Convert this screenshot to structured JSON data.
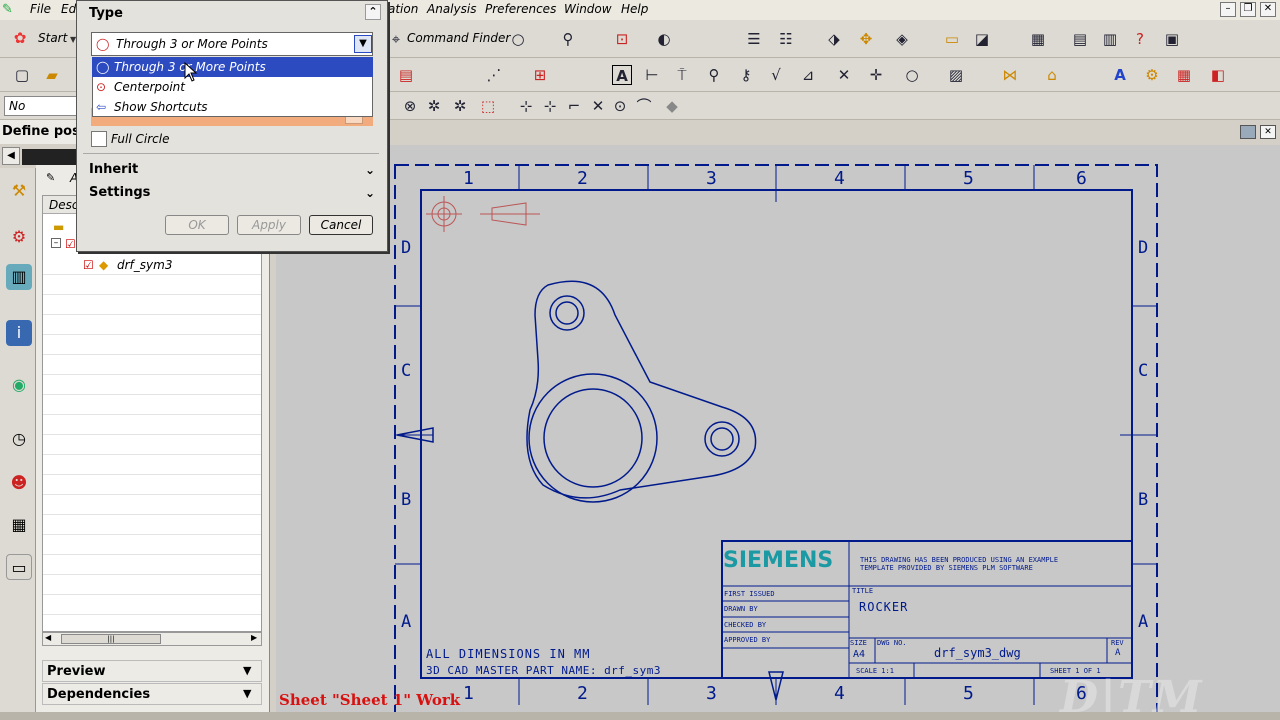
{
  "menubar": {
    "items": [
      "File",
      "Edi",
      "ation",
      "Analysis",
      "Preferences",
      "Window",
      "Help"
    ]
  },
  "toolbar": {
    "start_label": "Start",
    "command_finder_label": "Command Finder",
    "selection_filter": "No Selection"
  },
  "cue_line": "Define posi",
  "navigator": {
    "column_header": "Desc",
    "item_label": "drf_sym3",
    "preview_label": "Preview",
    "dependencies_label": "Dependencies"
  },
  "dialog": {
    "type_header": "Type",
    "selected_type": "Through 3 or More Points",
    "options": [
      "Through 3 or More Points",
      "Centerpoint",
      "Show Shortcuts"
    ],
    "full_circle_label": "Full Circle",
    "inherit_header": "Inherit",
    "settings_header": "Settings",
    "ok_label": "OK",
    "apply_label": "Apply",
    "cancel_label": "Cancel"
  },
  "drawing": {
    "column_labels": [
      "1",
      "2",
      "3",
      "4",
      "5",
      "6"
    ],
    "row_labels": [
      "D",
      "C",
      "B",
      "A"
    ],
    "note_dimensions": "ALL DIMENSIONS IN MM",
    "note_master": "3D CAD MASTER PART NAME: drf_sym3",
    "title_block": {
      "logo": "SIEMENS",
      "disclaimer_line1": "THIS DRAWING HAS BEEN PRODUCED USING AN EXAMPLE",
      "disclaimer_line2": "TEMPLATE PROVIDED BY SIEMENS PLM SOFTWARE",
      "first_issued": "FIRST ISSUED",
      "drawn_by": "DRAWN BY",
      "checked_by": "CHECKED BY",
      "approved_by": "APPROVED BY",
      "title_caption": "TITLE",
      "title_value": "ROCKER",
      "size_caption": "SIZE",
      "size_value": "A4",
      "dwg_caption": "DWG NO.",
      "dwg_value": "drf_sym3_dwg",
      "rev_caption": "REV",
      "rev_value": "A",
      "scale_label": "SCALE 1:1",
      "sheet_label": "SHEET 1 OF 1"
    },
    "line_color": "#001a8c"
  },
  "status_text": "Sheet \"Sheet 1\" Work",
  "watermark": "D|TM",
  "colors": {
    "highlight": "#2d4bc0",
    "status_red": "#d81010"
  }
}
